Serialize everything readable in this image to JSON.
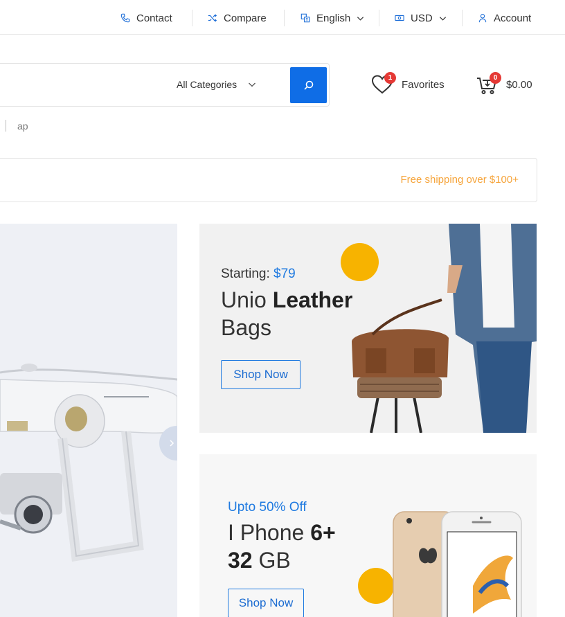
{
  "topbar": {
    "contact": "Contact",
    "compare": "Compare",
    "language": "English",
    "currency": "USD",
    "account": "Account"
  },
  "search": {
    "placeholder": "",
    "category": "All Categories"
  },
  "favorites": {
    "label": "Favorites",
    "count": "1"
  },
  "cart": {
    "total": "$0.00",
    "count": "0"
  },
  "recent_search": "ap",
  "shipping_note": "Free shipping over $100+",
  "banners": [
    {
      "pre": "Starting: ",
      "price": "$79",
      "title_light": "Unio ",
      "title_bold": "Leather",
      "title_line2": "Bags",
      "button": "Shop Now"
    },
    {
      "promo": "Upto 50% Off",
      "title_light": "I Phone ",
      "title_bold": "6+",
      "title_line2_bold": "32",
      "title_line2_light": " GB",
      "button": "Shop Now"
    }
  ],
  "colors": {
    "accent": "#0f6de6",
    "badge": "#e53935",
    "shipping": "#f6a43a",
    "dot": "#f7b300"
  }
}
